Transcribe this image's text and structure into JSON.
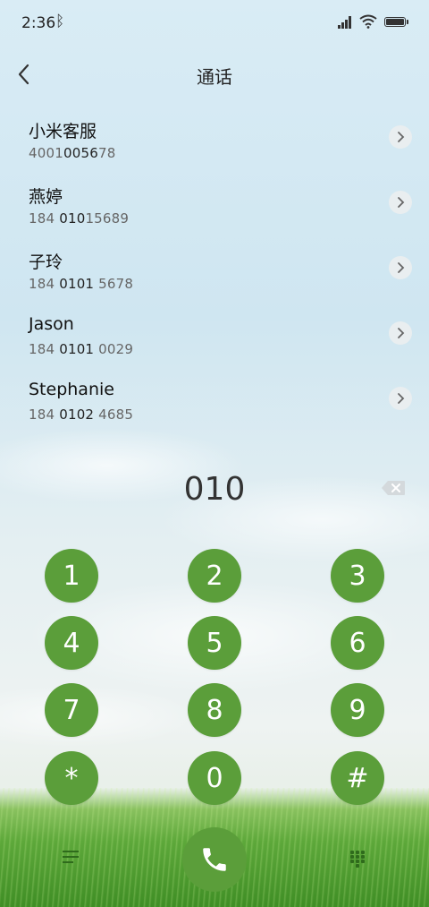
{
  "status_bar": {
    "time": "2:36",
    "bluetooth_icon": "ᛒ"
  },
  "header": {
    "title": "通话"
  },
  "contacts": [
    {
      "name": "小米客服",
      "number_prefix": "4001",
      "number_match": "0056",
      "number_suffix": "78"
    },
    {
      "name": "燕婷",
      "number_prefix": "184 ",
      "number_match": "010",
      "number_suffix": "15689"
    },
    {
      "name": "子玲",
      "number_prefix": "184 ",
      "number_match": "0101",
      "number_suffix": " 5678"
    },
    {
      "name": "Jason",
      "number_prefix": "184 ",
      "number_match": "0101",
      "number_suffix": " 0029"
    },
    {
      "name": "Stephanie",
      "number_prefix": "184 ",
      "number_match": "0102",
      "number_suffix": " 4685"
    }
  ],
  "dial": {
    "input": "010"
  },
  "keypad": [
    "1",
    "2",
    "3",
    "4",
    "5",
    "6",
    "7",
    "8",
    "9",
    "*",
    "0",
    "#"
  ],
  "colors": {
    "key_green": "#5b9e3a",
    "grass_dark": "#3f8e25"
  },
  "icons": {
    "back": "chevron-left-icon",
    "backspace": "backspace-icon",
    "call": "phone-icon",
    "menu": "menu-icon",
    "keypad": "dialpad-icon"
  }
}
